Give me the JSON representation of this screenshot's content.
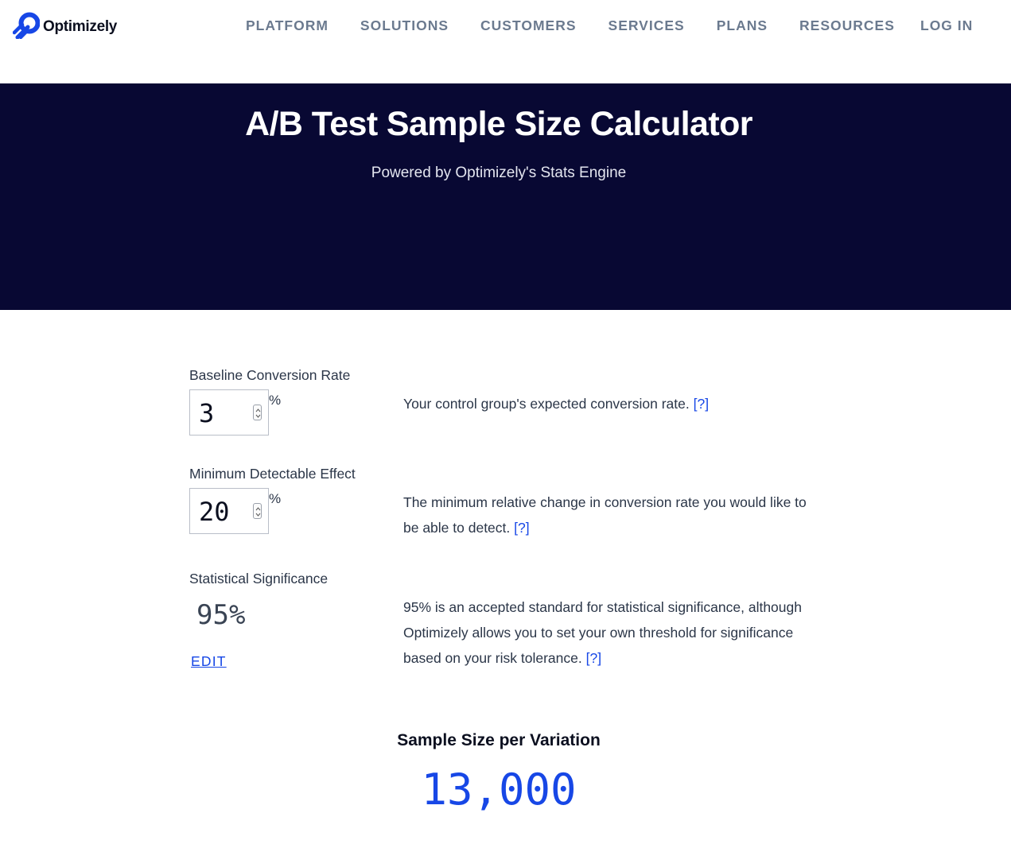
{
  "header": {
    "logo_text": "Optimizely",
    "nav": [
      "PLATFORM",
      "SOLUTIONS",
      "CUSTOMERS",
      "SERVICES",
      "PLANS",
      "RESOURCES"
    ],
    "login_label": "LOG IN"
  },
  "hero": {
    "title": "A/B Test Sample Size Calculator",
    "subtitle": "Powered by Optimizely's Stats Engine"
  },
  "calculator": {
    "baseline": {
      "label": "Baseline Conversion Rate",
      "value": "3",
      "unit": "%",
      "description": "Your control group's expected conversion rate.",
      "help": "[?]"
    },
    "mde": {
      "label": "Minimum Detectable Effect",
      "value": "20",
      "unit": "%",
      "description": "The minimum relative change in conversion rate you would like to be able to detect.",
      "help": "[?]"
    },
    "significance": {
      "label": "Statistical Significance",
      "value": "95%",
      "edit_label": "EDIT",
      "description": "95% is an accepted standard for statistical significance, although Optimizely allows you to set your own threshold for significance based on your risk tolerance.",
      "help": "[?]"
    }
  },
  "result": {
    "label": "Sample Size per Variation",
    "value": "13,000"
  },
  "colors": {
    "hero_bg": "#080833",
    "accent": "#1747e6",
    "nav_text": "#6b7a8f"
  }
}
